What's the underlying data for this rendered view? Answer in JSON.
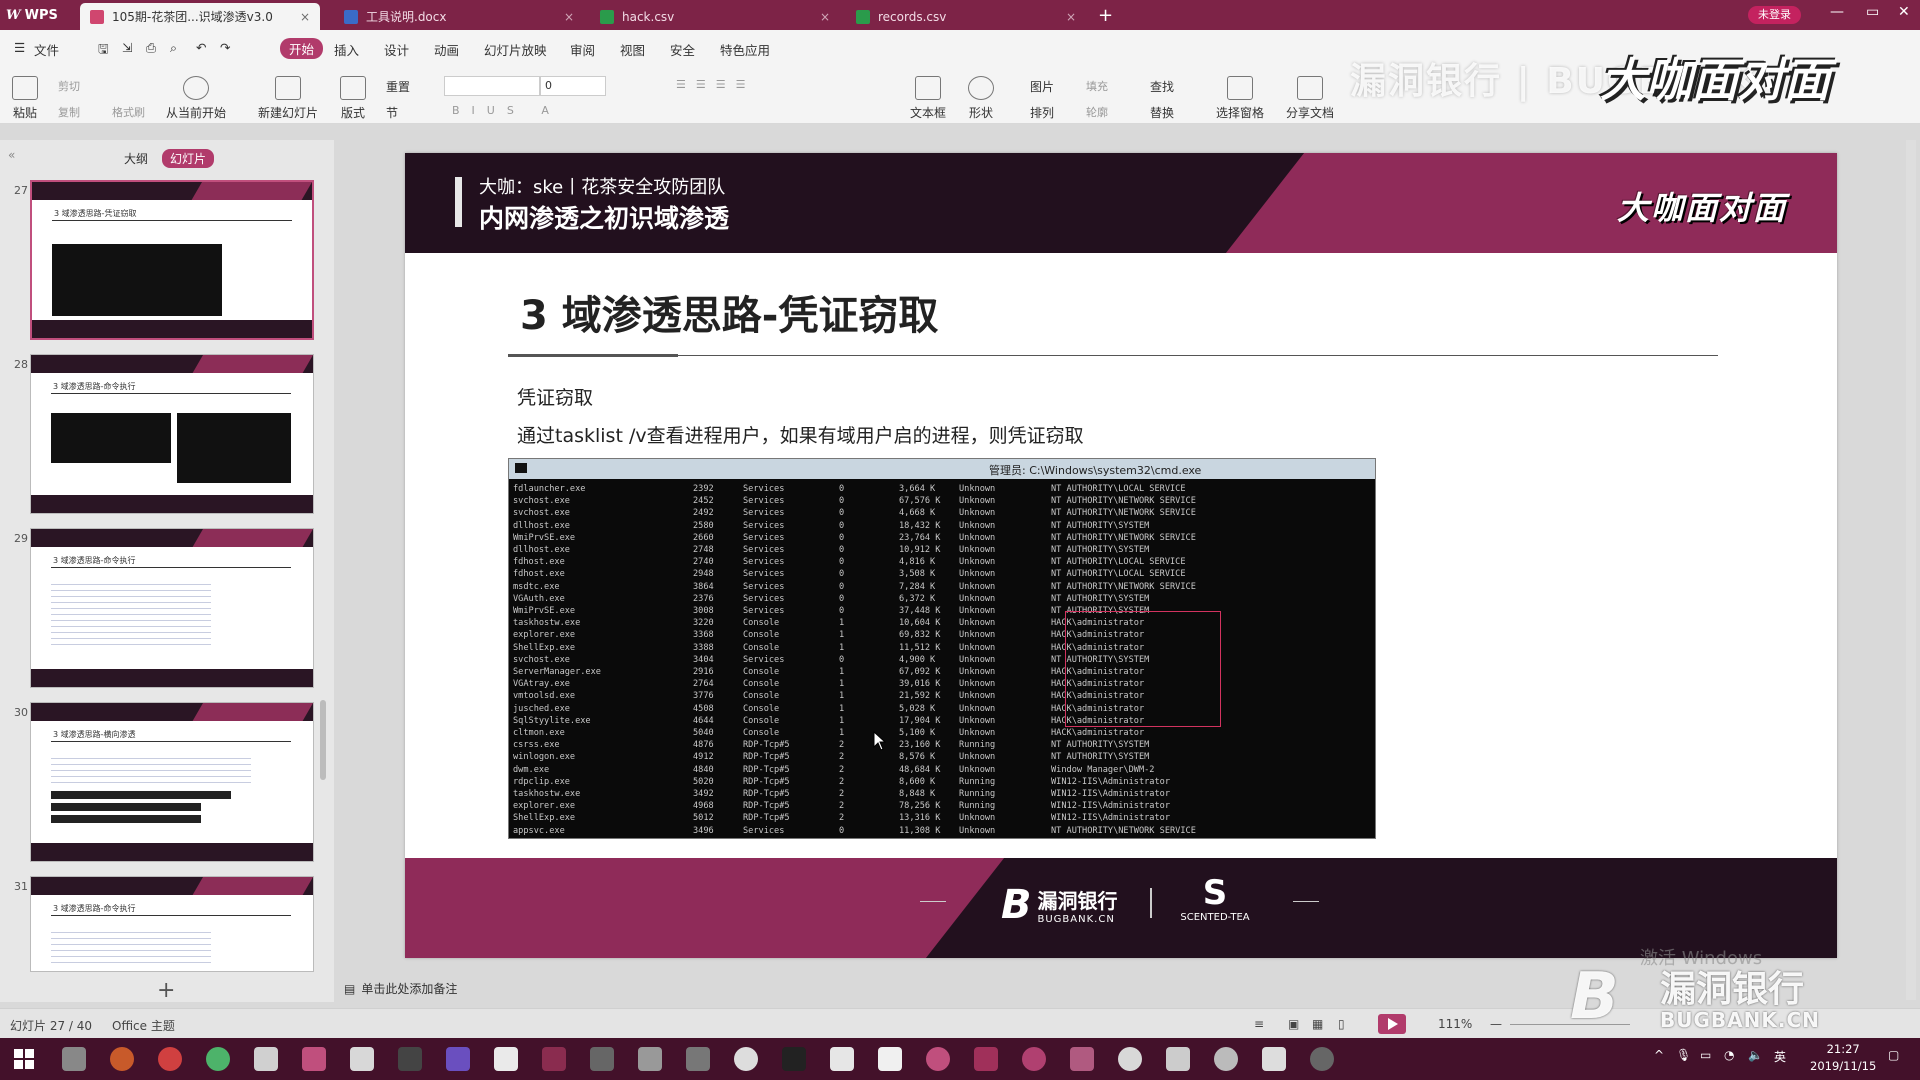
{
  "app": {
    "name": "WPS",
    "tabs": [
      {
        "label": "105期-花茶团...识域渗透v3.0",
        "color": "#d0466f"
      },
      {
        "label": "工具说明.docx",
        "color": "#3a6bc8"
      },
      {
        "label": "hack.csv",
        "color": "#2a9b4b"
      },
      {
        "label": "records.csv",
        "color": "#2a9b4b"
      }
    ],
    "login_label": "未登录"
  },
  "menu": {
    "file": "文件",
    "items": [
      "开始",
      "插入",
      "设计",
      "动画",
      "幻灯片放映",
      "审阅",
      "视图",
      "安全",
      "特色应用"
    ]
  },
  "ribbon": {
    "paste": "粘贴",
    "cut": "剪切",
    "copy": "复制",
    "format_painter": "格式刷",
    "from_current": "从当前开始",
    "new_slide": "新建幻灯片",
    "layout": "版式",
    "reset": "重置",
    "section": "节",
    "font_size": "0",
    "textbox": "文本框",
    "shape": "形状",
    "picture": "图片",
    "arrange": "排列",
    "fill": "填充",
    "outline": "轮廓",
    "find": "查找",
    "replace": "替换",
    "select_pane": "选择窗格",
    "share": "分享文档"
  },
  "left_panel": {
    "outline_tab": "大纲",
    "slides_tab": "幻灯片",
    "thumbs": [
      {
        "num": "27",
        "title": "3 域渗透思路-凭证窃取"
      },
      {
        "num": "28",
        "title": "3 域渗透思路-命令执行"
      },
      {
        "num": "29",
        "title": "3 域渗透思路-命令执行"
      },
      {
        "num": "30",
        "title": "3 域渗透思路-横向渗透"
      },
      {
        "num": "31",
        "title": "3 域渗透思路-命令执行"
      }
    ]
  },
  "slide": {
    "header_sub": "大咖：ske丨花茶安全攻防团队",
    "header_title": "内网渗透之初识域渗透",
    "brand": "大咖面对面",
    "heading": "3 域渗透思路-凭证窃取",
    "p1": "凭证窃取",
    "p2": "通过tasklist /v查看进程用户，如果有域用户启的进程，则凭证窃取",
    "cmd_title": "管理员: C:\\Windows\\system32\\cmd.exe",
    "cmd_rows": [
      [
        "fdlauncher.exe",
        "2392",
        "Services",
        "0",
        "3,664 K",
        "Unknown",
        "NT AUTHORITY\\LOCAL SERVICE"
      ],
      [
        "svchost.exe",
        "2452",
        "Services",
        "0",
        "67,576 K",
        "Unknown",
        "NT AUTHORITY\\NETWORK SERVICE"
      ],
      [
        "svchost.exe",
        "2492",
        "Services",
        "0",
        "4,668 K",
        "Unknown",
        "NT AUTHORITY\\NETWORK SERVICE"
      ],
      [
        "dllhost.exe",
        "2580",
        "Services",
        "0",
        "18,432 K",
        "Unknown",
        "NT AUTHORITY\\SYSTEM"
      ],
      [
        "WmiPrvSE.exe",
        "2660",
        "Services",
        "0",
        "23,764 K",
        "Unknown",
        "NT AUTHORITY\\NETWORK SERVICE"
      ],
      [
        "dllhost.exe",
        "2748",
        "Services",
        "0",
        "10,912 K",
        "Unknown",
        "NT AUTHORITY\\SYSTEM"
      ],
      [
        "fdhost.exe",
        "2740",
        "Services",
        "0",
        "4,816 K",
        "Unknown",
        "NT AUTHORITY\\LOCAL SERVICE"
      ],
      [
        "fdhost.exe",
        "2948",
        "Services",
        "0",
        "3,508 K",
        "Unknown",
        "NT AUTHORITY\\LOCAL SERVICE"
      ],
      [
        "msdtc.exe",
        "3864",
        "Services",
        "0",
        "7,284 K",
        "Unknown",
        "NT AUTHORITY\\NETWORK SERVICE"
      ],
      [
        "VGAuth.exe",
        "2376",
        "Services",
        "0",
        "6,372 K",
        "Unknown",
        "NT AUTHORITY\\SYSTEM"
      ],
      [
        "WmiPrvSE.exe",
        "3008",
        "Services",
        "0",
        "37,448 K",
        "Unknown",
        "NT AUTHORITY\\SYSTEM"
      ],
      [
        "taskhostw.exe",
        "3220",
        "Console",
        "1",
        "10,604 K",
        "Unknown",
        "HACK\\administrator"
      ],
      [
        "explorer.exe",
        "3368",
        "Console",
        "1",
        "69,832 K",
        "Unknown",
        "HACK\\administrator"
      ],
      [
        "ShellExp.exe",
        "3388",
        "Console",
        "1",
        "11,512 K",
        "Unknown",
        "HACK\\administrator"
      ],
      [
        "svchost.exe",
        "3404",
        "Services",
        "0",
        "4,900 K",
        "Unknown",
        "NT AUTHORITY\\SYSTEM"
      ],
      [
        "ServerManager.exe",
        "2916",
        "Console",
        "1",
        "67,092 K",
        "Unknown",
        "HACK\\administrator"
      ],
      [
        "VGAtray.exe",
        "2764",
        "Console",
        "1",
        "39,016 K",
        "Unknown",
        "HACK\\administrator"
      ],
      [
        "vmtoolsd.exe",
        "3776",
        "Console",
        "1",
        "21,592 K",
        "Unknown",
        "HACK\\administrator"
      ],
      [
        "jusched.exe",
        "4508",
        "Console",
        "1",
        "5,028 K",
        "Unknown",
        "HACK\\administrator"
      ],
      [
        "SqlStyylite.exe",
        "4644",
        "Console",
        "1",
        "17,904 K",
        "Unknown",
        "HACK\\administrator"
      ],
      [
        "cltmon.exe",
        "5040",
        "Console",
        "1",
        "5,100 K",
        "Unknown",
        "HACK\\administrator"
      ],
      [
        "csrss.exe",
        "4876",
        "RDP-Tcp#5",
        "2",
        "23,160 K",
        "Running",
        "NT AUTHORITY\\SYSTEM"
      ],
      [
        "winlogon.exe",
        "4912",
        "RDP-Tcp#5",
        "2",
        "8,576 K",
        "Unknown",
        "NT AUTHORITY\\SYSTEM"
      ],
      [
        "dwm.exe",
        "4840",
        "RDP-Tcp#5",
        "2",
        "48,684 K",
        "Unknown",
        "Window Manager\\DWM-2"
      ],
      [
        "rdpclip.exe",
        "5020",
        "RDP-Tcp#5",
        "2",
        "8,600 K",
        "Running",
        "WIN12-IIS\\Administrator"
      ],
      [
        "taskhostw.exe",
        "3492",
        "RDP-Tcp#5",
        "2",
        "8,848 K",
        "Running",
        "WIN12-IIS\\Administrator"
      ],
      [
        "explorer.exe",
        "4968",
        "RDP-Tcp#5",
        "2",
        "78,256 K",
        "Running",
        "WIN12-IIS\\Administrator"
      ],
      [
        "ShellExp.exe",
        "5012",
        "RDP-Tcp#5",
        "2",
        "13,316 K",
        "Unknown",
        "WIN12-IIS\\Administrator"
      ],
      [
        "appsvc.exe",
        "3496",
        "Services",
        "0",
        "11,308 K",
        "Unknown",
        "NT AUTHORITY\\NETWORK SERVICE"
      ]
    ],
    "footer_logo1_cn": "漏洞银行",
    "footer_logo1_en": "BUGBANK.CN",
    "footer_logo2_en": "SCENTED-TEA"
  },
  "notes_placeholder": "单击此处添加备注",
  "status": {
    "slide_info": "幻灯片 27 / 40",
    "theme": "Office 主题",
    "zoom": "111%"
  },
  "watermark": {
    "top_cn": "漏洞银行",
    "top_sep": "|",
    "top_en": "BUGBANK",
    "top_brand": "大咖面对面",
    "bottom_cn": "漏洞银行",
    "bottom_en": "BUGBANK.CN",
    "activate": "激活 Windows"
  },
  "taskbar": {
    "ime": "英",
    "time": "21:27",
    "date": "2019/11/15"
  },
  "colors": {
    "accent": "#b13b6b",
    "title_bar": "#7d2347",
    "slide_dark": "#22101e",
    "slide_band": "#8f2b59",
    "taskbar": "#43112a"
  }
}
